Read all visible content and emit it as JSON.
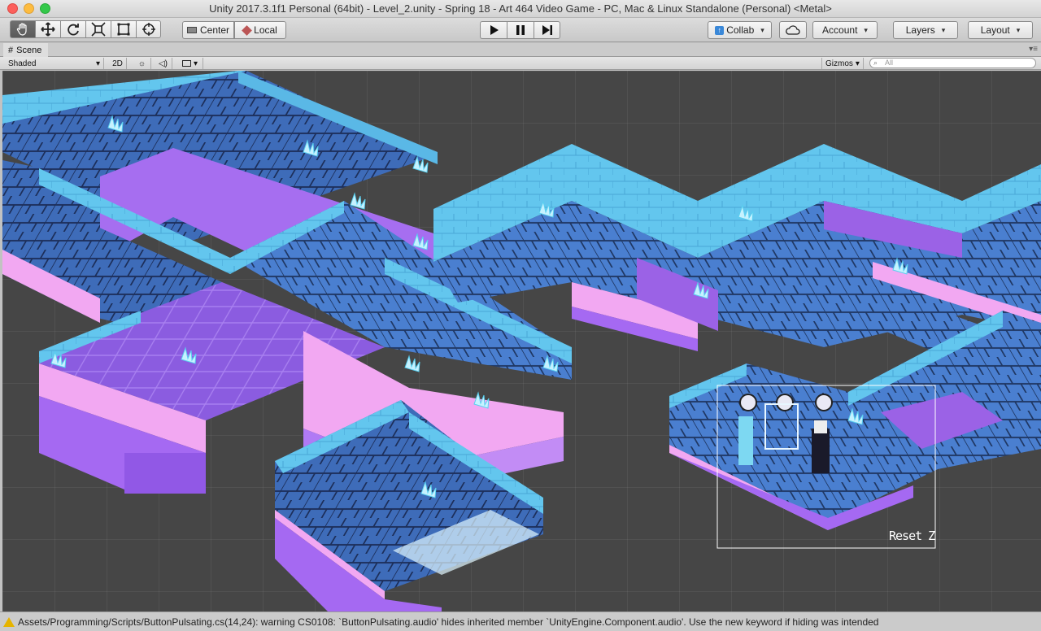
{
  "window": {
    "title": "Unity 2017.3.1f1 Personal (64bit) - Level_2.unity - Spring 18 - Art 464 Video Game - PC, Mac & Linux Standalone (Personal) <Metal>"
  },
  "toolbar": {
    "pivot_label": "Center",
    "space_label": "Local",
    "collab_label": "Collab",
    "account_label": "Account",
    "layers_label": "Layers",
    "layout_label": "Layout"
  },
  "scene_tab": {
    "label": "Scene"
  },
  "scene_bar": {
    "draw_mode": "Shaded",
    "mode_2d": "2D",
    "gizmos_label": "Gizmos",
    "search_placeholder": "All"
  },
  "viewport": {
    "selected_label": "Reset Z"
  },
  "status": {
    "message": "Assets/Programming/Scripts/ButtonPulsating.cs(14,24): warning CS0108: `ButtonPulsating.audio' hides inherited member `UnityEngine.Component.audio'. Use the new keyword if hiding was intended"
  },
  "colors": {
    "viewport_bg": "#464646",
    "tile_blue": "#4a78c8",
    "tile_purple": "#9b62e6",
    "wall_cyan": "#6fd7f0",
    "pink": "#f4a0f0"
  }
}
